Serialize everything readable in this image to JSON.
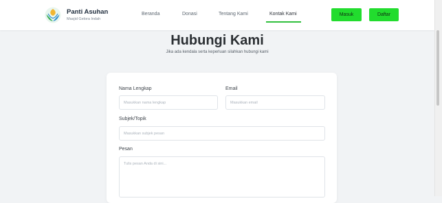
{
  "header": {
    "brand_name": "Panti Asuhan",
    "brand_subtitle": "Masjid Gelora Indah",
    "nav": [
      {
        "label": "Beranda"
      },
      {
        "label": "Donasi"
      },
      {
        "label": "Tentang Kami"
      },
      {
        "label": "Kontak Kami",
        "active": true
      }
    ],
    "login_label": "Masuk",
    "register_label": "Daftar"
  },
  "main": {
    "title": "Hubungi Kami",
    "subtitle": "Jika ada kendala serta keperluan silahkan hubungi kami"
  },
  "form": {
    "name_label": "Nama Lengkap",
    "name_placeholder": "Masukkan nama lengkap",
    "email_label": "Email",
    "email_placeholder": "Masukkan email",
    "subject_label": "Subjek/Topik",
    "subject_placeholder": "Masukkan subjek pesan",
    "message_label": "Pesan",
    "message_placeholder": "Tulis pesan Anda di sini..."
  },
  "colors": {
    "accent_green": "#22dc2e",
    "active_underline": "#2fbf3c",
    "page_background": "#f1f3f5"
  },
  "icons": {
    "logo": "leaf-hands-logo-icon"
  }
}
